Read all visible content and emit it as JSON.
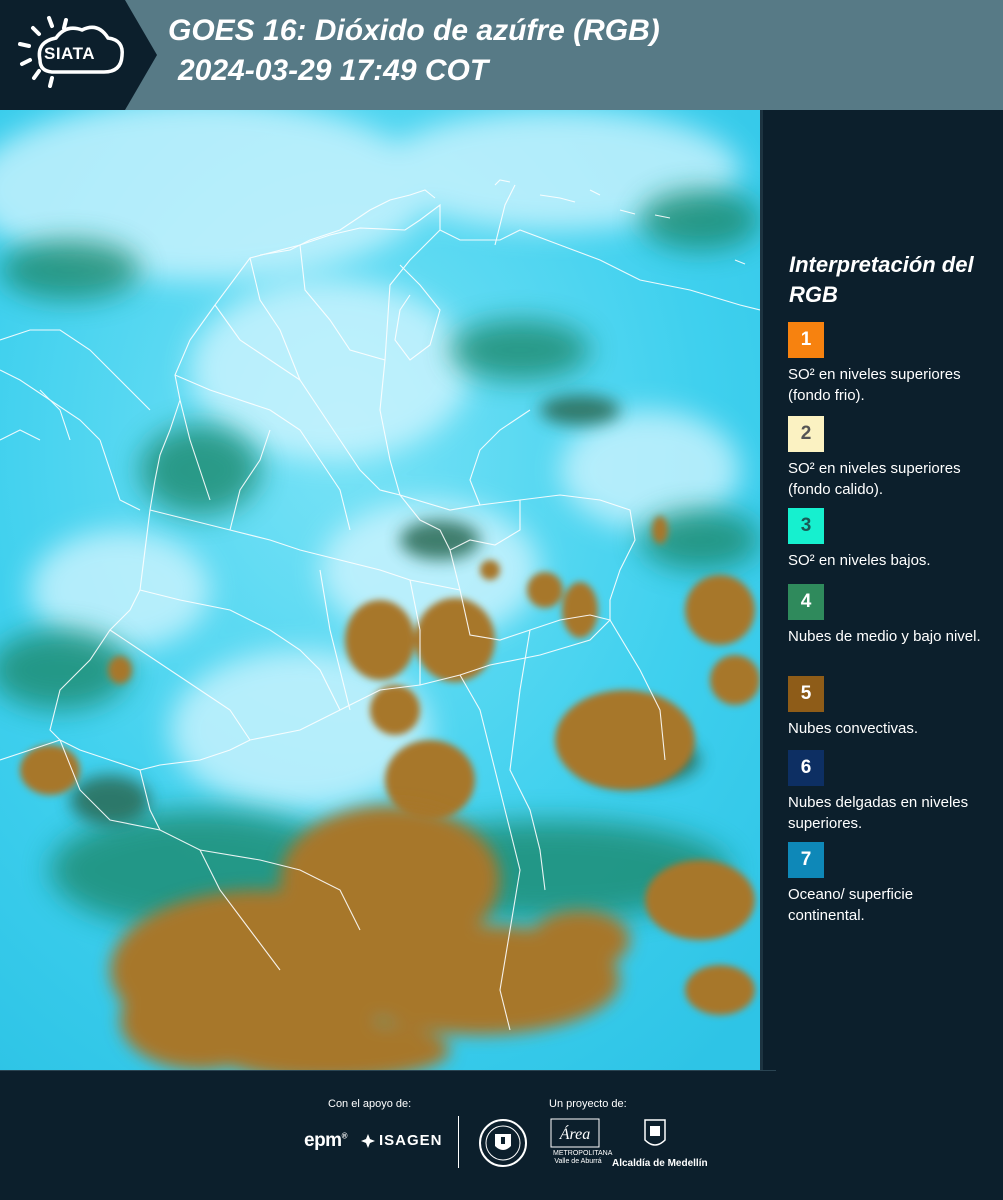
{
  "header": {
    "logo_text": "SIATA",
    "title_line1": "GOES 16: Dióxido de azúfre (RGB)",
    "title_line2": "2024-03-29 17:49 COT",
    "background_color": "#577a86"
  },
  "map": {
    "description_icon": "satellite-rgb-image",
    "colors": {
      "background_cyan": "#3fd0ee",
      "cloud_white": "#bfefff",
      "convective_brown": "#a7772a",
      "mid_low_green": "#2e7a5a",
      "boundary_line": "#ffffff"
    }
  },
  "legend": {
    "title": "Interpretación del RGB",
    "items": [
      {
        "number": "1",
        "color": "#f7820f",
        "number_color": "#ffffff",
        "text": "SO² en niveles superiores (fondo frio)."
      },
      {
        "number": "2",
        "color": "#fbf2c2",
        "number_color": "#555555",
        "text": "SO² en niveles superiores (fondo calido)."
      },
      {
        "number": "3",
        "color": "#16f0cf",
        "number_color": "#1a5a55",
        "text": "SO² en niveles bajos."
      },
      {
        "number": "4",
        "color": "#2f8a5c",
        "number_color": "#ffffff",
        "text": "Nubes de medio y bajo nivel."
      },
      {
        "number": "5",
        "color": "#8e5c18",
        "number_color": "#ffffff",
        "text": "Nubes convectivas."
      },
      {
        "number": "6",
        "color": "#0d2f63",
        "number_color": "#ffffff",
        "text": "Nubes delgadas en niveles superiores."
      },
      {
        "number": "7",
        "color": "#0e88b8",
        "number_color": "#ffffff",
        "text": "Oceano/ superficie continental."
      }
    ]
  },
  "footer": {
    "support_label": "Con el apoyo de:",
    "project_label": "Un proyecto de:",
    "epm": "epm",
    "isagen": "ISAGEN",
    "area_name": "Área",
    "area_subtitle": "METROPOLITANA Valle de Aburrá",
    "alcaldia": "Alcaldía de Medellín"
  }
}
